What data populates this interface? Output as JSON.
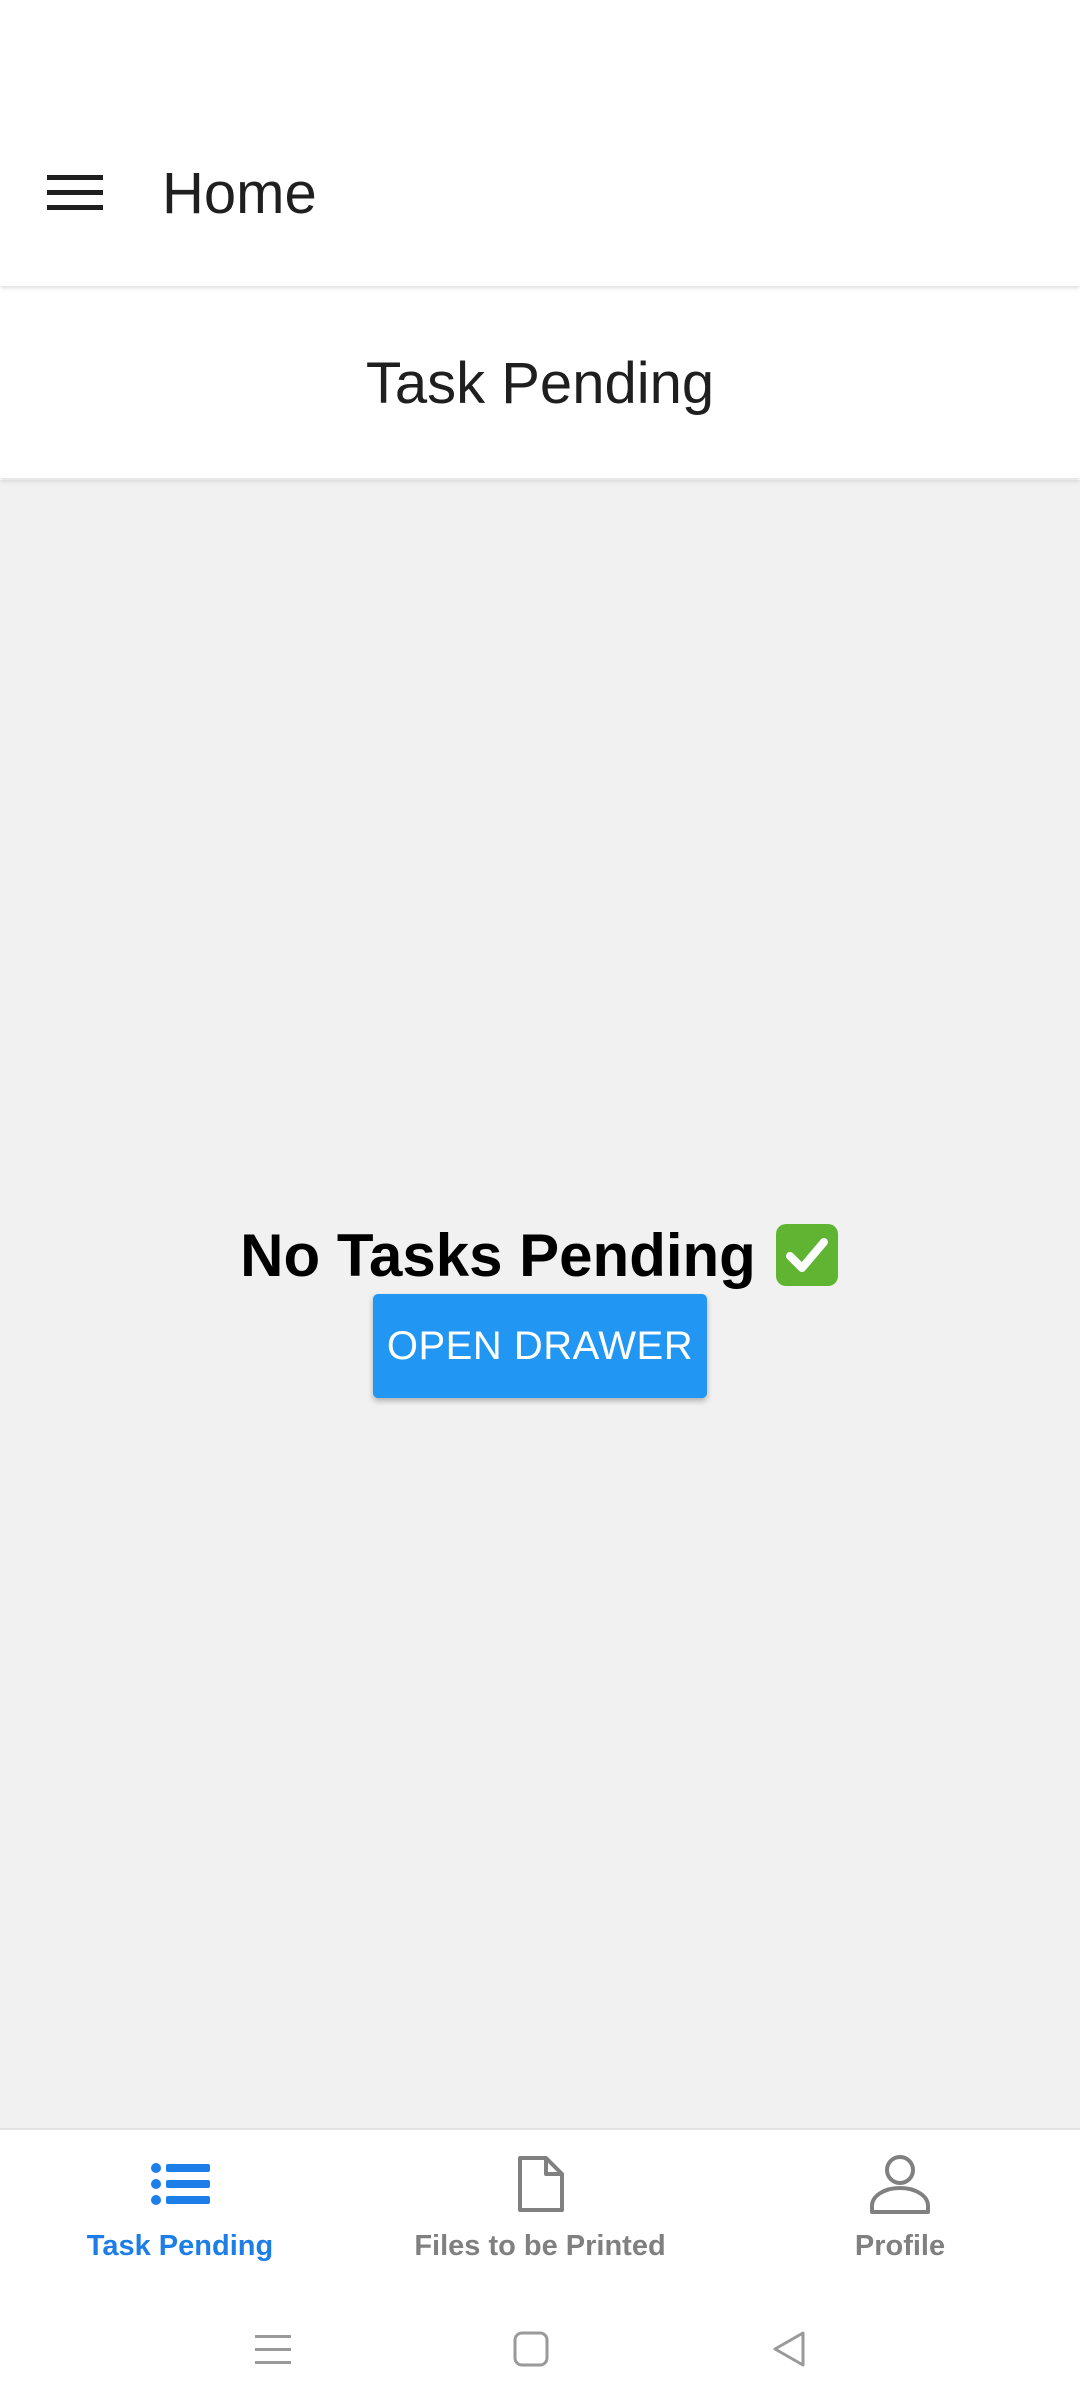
{
  "app_bar": {
    "title": "Home",
    "menu_icon": "hamburger-menu-icon"
  },
  "sub_header": {
    "title": "Task Pending"
  },
  "main": {
    "empty_message": "No Tasks Pending",
    "empty_icon": "check-mark-button-emoji",
    "open_drawer_label": "OPEN DRAWER",
    "button_color": "#2196f3"
  },
  "bottom_nav": {
    "active_color": "#1e7ee8",
    "inactive_color": "#808080",
    "tabs": [
      {
        "label": "Task Pending",
        "icon": "list-icon",
        "active": true
      },
      {
        "label": "Files to be Printed",
        "icon": "file-icon",
        "active": false
      },
      {
        "label": "Profile",
        "icon": "person-icon",
        "active": false
      }
    ]
  },
  "system_nav": {
    "buttons": [
      "recent-apps-icon",
      "home-icon",
      "back-icon"
    ]
  }
}
